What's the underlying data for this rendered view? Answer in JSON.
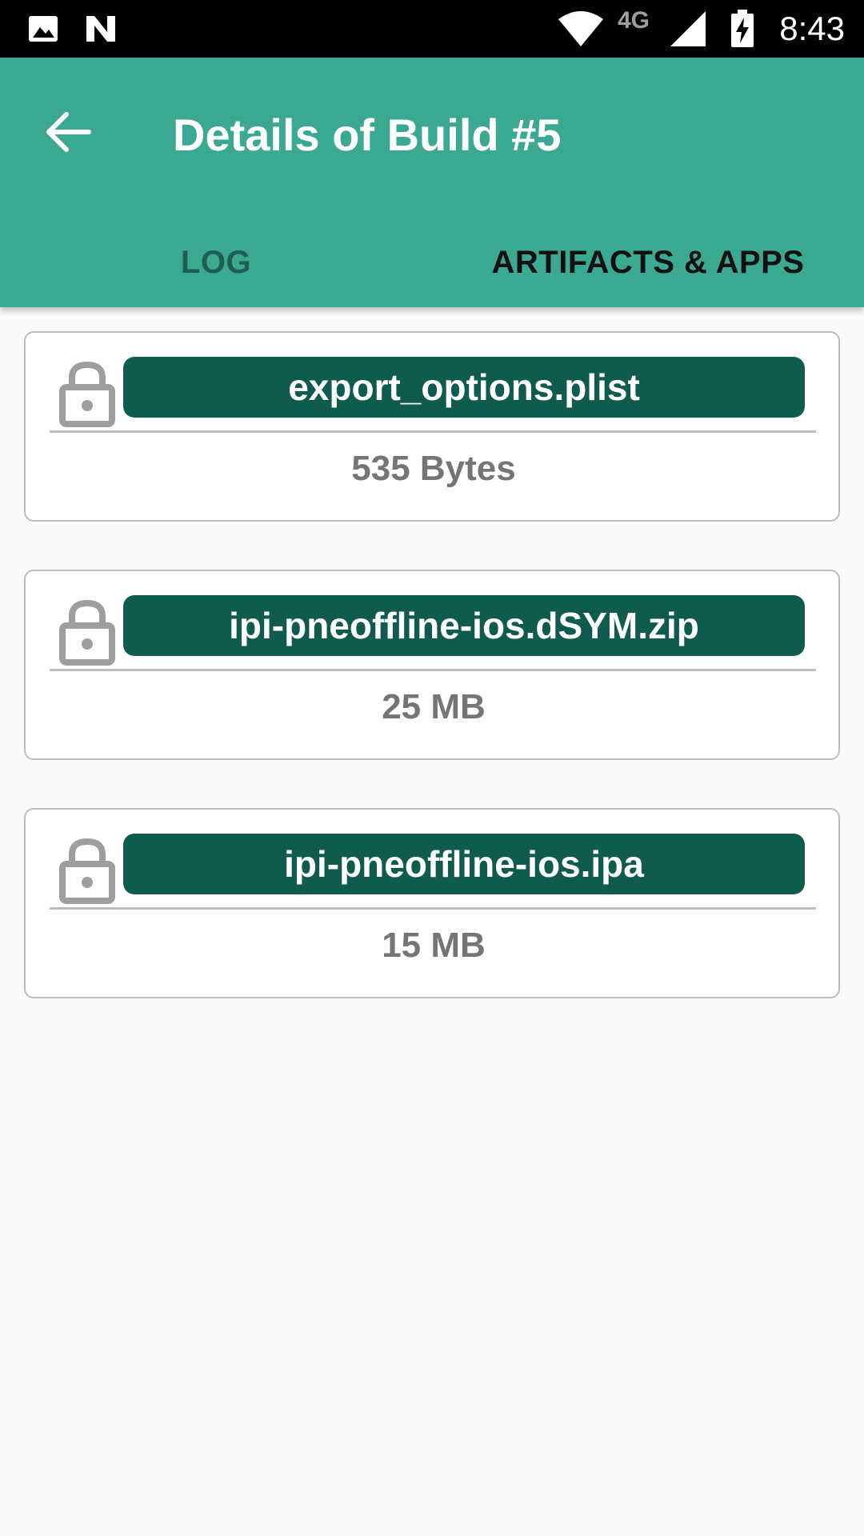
{
  "status_bar": {
    "time": "8:43",
    "network_label": "4G",
    "icons": [
      "image-icon",
      "n-icon",
      "wifi-icon",
      "signal-icon",
      "battery-charging-icon"
    ]
  },
  "app_bar": {
    "title": "Details of Build #5",
    "back_icon": "arrow-back-icon",
    "color": "#3ba892"
  },
  "tabs": [
    {
      "label": "LOG",
      "active": false
    },
    {
      "label": "ARTIFACTS & APPS",
      "active": true
    }
  ],
  "artifacts": [
    {
      "name": "export_options.plist",
      "size": "535 Bytes",
      "icon": "lock-icon"
    },
    {
      "name": "ipi-pneoffline-ios.dSYM.zip",
      "size": "25 MB",
      "icon": "lock-icon"
    },
    {
      "name": "ipi-pneoffline-ios.ipa",
      "size": "15 MB",
      "icon": "lock-icon"
    }
  ],
  "colors": {
    "accent": "#3ba892",
    "button": "#0f5b4e",
    "muted_text": "#757575"
  }
}
